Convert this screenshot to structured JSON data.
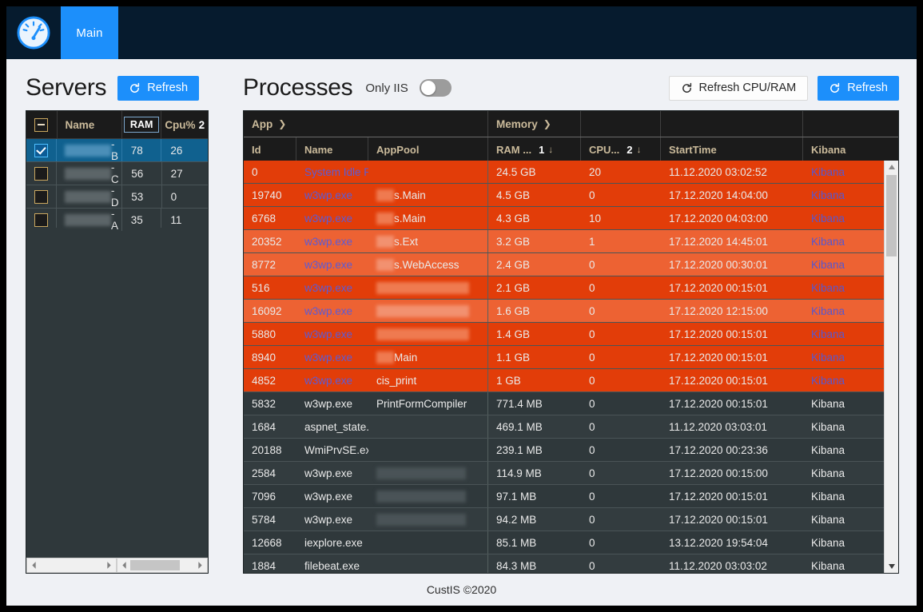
{
  "navbar": {
    "brand_icon": "gauge-icon",
    "tabs": [
      {
        "label": "Main",
        "active": true
      }
    ]
  },
  "servers_panel": {
    "title": "Servers",
    "refresh_label": "Refresh",
    "refresh_icon": "refresh-icon",
    "columns": [
      "",
      "Name",
      "RAM",
      "Cpu%"
    ],
    "ram_sort_index": "",
    "cpu_sort_index": "2",
    "rows": [
      {
        "checked": true,
        "name_suffix": "-B",
        "ram": "78",
        "cpu": "26",
        "redact_w": 62
      },
      {
        "checked": false,
        "name_suffix": "-C",
        "ram": "56",
        "cpu": "27",
        "redact_w": 62
      },
      {
        "checked": false,
        "name_suffix": "-D",
        "ram": "53",
        "cpu": "0",
        "redact_w": 62
      },
      {
        "checked": false,
        "name_suffix": "-A",
        "ram": "35",
        "cpu": "11",
        "redact_w": 62
      }
    ]
  },
  "processes_panel": {
    "title": "Processes",
    "only_iis_label": "Only IIS",
    "only_iis_on": false,
    "refresh_cpu_ram_label": "Refresh CPU/RAM",
    "refresh_label": "Refresh",
    "refresh_icon": "refresh-icon",
    "group_headers": [
      {
        "label": "App",
        "chevron": "❯"
      },
      {
        "label": "Memory",
        "chevron": "❯"
      },
      {
        "label": ""
      },
      {
        "label": ""
      },
      {
        "label": ""
      }
    ],
    "columns": [
      {
        "label": "Id"
      },
      {
        "label": "Name"
      },
      {
        "label": "AppPool"
      },
      {
        "label": "RAM ...",
        "sort_index": "1",
        "sort_dir": "↓"
      },
      {
        "label": "CPU...",
        "sort_index": "2",
        "sort_dir": "↓"
      },
      {
        "label": "StartTime"
      },
      {
        "label": "Kibana"
      }
    ],
    "kibana_label": "Kibana",
    "rows": [
      {
        "id": "0",
        "name": "System Idle Pro",
        "pool": "",
        "pool_redact": 0,
        "ram": "24.5 GB",
        "cpu": "20",
        "start": "11.12.2020 03:02:52",
        "style": "red"
      },
      {
        "id": "19740",
        "name": "w3wp.exe",
        "pool": "s.Main",
        "pool_redact": 22,
        "ram": "4.5 GB",
        "cpu": "0",
        "start": "17.12.2020 14:04:00",
        "style": "red"
      },
      {
        "id": "6768",
        "name": "w3wp.exe",
        "pool": "s.Main",
        "pool_redact": 22,
        "ram": "4.3 GB",
        "cpu": "10",
        "start": "17.12.2020 04:03:00",
        "style": "red"
      },
      {
        "id": "20352",
        "name": "w3wp.exe",
        "pool": "s.Ext",
        "pool_redact": 22,
        "ram": "3.2 GB",
        "cpu": "1",
        "start": "17.12.2020 14:45:01",
        "style": "redl"
      },
      {
        "id": "8772",
        "name": "w3wp.exe",
        "pool": "s.WebAccess",
        "pool_redact": 22,
        "ram": "2.4 GB",
        "cpu": "0",
        "start": "17.12.2020 00:30:01",
        "style": "redl"
      },
      {
        "id": "516",
        "name": "w3wp.exe",
        "pool": "",
        "pool_redact": 116,
        "ram": "2.1 GB",
        "cpu": "0",
        "start": "17.12.2020 00:15:01",
        "style": "red"
      },
      {
        "id": "16092",
        "name": "w3wp.exe",
        "pool": "",
        "pool_redact": 116,
        "ram": "1.6 GB",
        "cpu": "0",
        "start": "17.12.2020 12:15:00",
        "style": "redl"
      },
      {
        "id": "5880",
        "name": "w3wp.exe",
        "pool": "",
        "pool_redact": 116,
        "ram": "1.4 GB",
        "cpu": "0",
        "start": "17.12.2020 00:15:01",
        "style": "red"
      },
      {
        "id": "8940",
        "name": "w3wp.exe",
        "pool": "Main",
        "pool_redact": 22,
        "ram": "1.1 GB",
        "cpu": "0",
        "start": "17.12.2020 00:15:01",
        "style": "red"
      },
      {
        "id": "4852",
        "name": "w3wp.exe",
        "pool": "cis_print",
        "pool_redact": 0,
        "ram": "1 GB",
        "cpu": "0",
        "start": "17.12.2020 00:15:01",
        "style": "red"
      },
      {
        "id": "5832",
        "name": "w3wp.exe",
        "pool": "PrintFormCompiler",
        "pool_redact": 0,
        "ram": "771.4 MB",
        "cpu": "0",
        "start": "17.12.2020 00:15:01",
        "style": "dark"
      },
      {
        "id": "1684",
        "name": "aspnet_state.ex",
        "pool": "",
        "pool_redact": 0,
        "ram": "469.1 MB",
        "cpu": "0",
        "start": "11.12.2020 03:03:01",
        "style": "dark2"
      },
      {
        "id": "20188",
        "name": "WmiPrvSE.exe",
        "pool": "",
        "pool_redact": 0,
        "ram": "239.1 MB",
        "cpu": "0",
        "start": "17.12.2020 00:23:36",
        "style": "dark"
      },
      {
        "id": "2584",
        "name": "w3wp.exe",
        "pool": "",
        "pool_redact": 112,
        "ram": "114.9 MB",
        "cpu": "0",
        "start": "17.12.2020 00:15:00",
        "style": "dark2"
      },
      {
        "id": "7096",
        "name": "w3wp.exe",
        "pool": "",
        "pool_redact": 112,
        "ram": "97.1 MB",
        "cpu": "0",
        "start": "17.12.2020 00:15:01",
        "style": "dark"
      },
      {
        "id": "5784",
        "name": "w3wp.exe",
        "pool": "",
        "pool_redact": 112,
        "ram": "94.2 MB",
        "cpu": "0",
        "start": "17.12.2020 00:15:01",
        "style": "dark2"
      },
      {
        "id": "12668",
        "name": "iexplore.exe",
        "pool": "",
        "pool_redact": 0,
        "ram": "85.1 MB",
        "cpu": "0",
        "start": "13.12.2020 19:54:04",
        "style": "dark"
      },
      {
        "id": "1884",
        "name": "filebeat.exe",
        "pool": "",
        "pool_redact": 0,
        "ram": "84.3 MB",
        "cpu": "0",
        "start": "11.12.2020 03:03:02",
        "style": "dark2"
      }
    ]
  },
  "footer": {
    "text": "CustIS ©2020"
  },
  "colors": {
    "navbar_bg": "#061b2e",
    "accent": "#1c8ffb",
    "grid_dark": "#2f383b",
    "grid_header": "#1b1b1b",
    "row_red": "#e23d09",
    "row_red_light": "#ed6233",
    "selected_row": "#10618f",
    "header_text": "#cbbb9b",
    "link": "#3aa0ff"
  }
}
